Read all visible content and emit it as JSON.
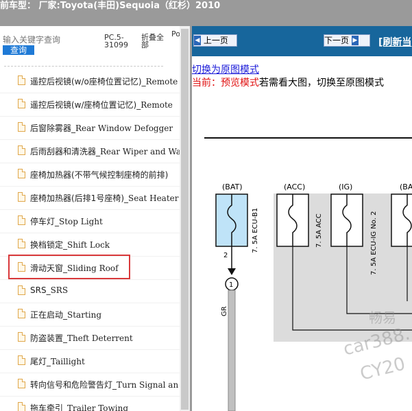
{
  "window": {
    "title": "前车型： 厂家:Toyota(丰田)Sequoia（红杉）2010"
  },
  "sidebar": {
    "search_placeholder": "输入关键字查询",
    "search_button": "查询",
    "columns": [
      "PC.5-31099",
      "折叠全部",
      "Po"
    ],
    "items": [
      {
        "cn": "遥控后视镜(w/o座椅位置记忆)_",
        "en": "Remote"
      },
      {
        "cn": "遥控后视镜(w/座椅位置记忆)_",
        "en": "Remote"
      },
      {
        "cn": "后窗除雾器_",
        "en": "Rear Window Defogger"
      },
      {
        "cn": "后雨刮器和清洗器_",
        "en": "Rear Wiper and Wa"
      },
      {
        "cn": "座椅加热器(不带气候控制座椅的前排)",
        "en": ""
      },
      {
        "cn": "座椅加热器(后排1号座椅)_",
        "en": "Seat Heater"
      },
      {
        "cn": "停车灯_",
        "en": "Stop Light"
      },
      {
        "cn": "换档锁定_",
        "en": "Shift Lock"
      },
      {
        "cn": "滑动天窗_",
        "en": "Sliding Roof"
      },
      {
        "cn": "SRS_",
        "en": "SRS"
      },
      {
        "cn": "正在启动_",
        "en": "Starting"
      },
      {
        "cn": "防盗装置_",
        "en": "Theft Deterrent"
      },
      {
        "cn": "尾灯_",
        "en": "Taillight"
      },
      {
        "cn": "转向信号和危险警告灯_",
        "en": "Turn Signal an"
      },
      {
        "cn": "拖车牵引_",
        "en": "Trailer Towing"
      }
    ],
    "selected_index": 8
  },
  "viewer": {
    "prev_label": "上一页",
    "next_label": "下一页",
    "refresh_label": "[刷新当",
    "mode_link": "切换为原图模式",
    "notice_red": "当前：预览模式",
    "notice_black": "若需看大图，切换至原图模式"
  },
  "diagram": {
    "labels": {
      "bat": "(BAT)",
      "acc": "(ACC)",
      "ig": "(IG)",
      "ba": "(BA",
      "fuse1": "7. 5A ECU-B1",
      "fuse2": "7. 5A ACC",
      "fuse3": "7. 5A ECU-IG No. 2",
      "pin": "2",
      "connector": "1",
      "wire": "GR"
    },
    "colors": {
      "fuse_fill": "#bfe3f8",
      "block_fill": "#dcdcdc",
      "wire_fill": "#c0c0c0"
    }
  },
  "watermark": [
    "畅易",
    "car388.",
    "CY20"
  ]
}
